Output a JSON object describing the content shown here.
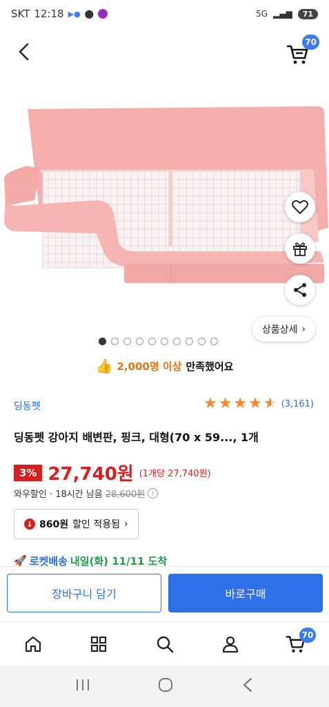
{
  "status_bar": {
    "carrier": "SKT",
    "time": "12:18",
    "network": "5G",
    "battery": "71"
  },
  "header": {
    "cart_count": "70"
  },
  "product_image": {
    "dot_count": 10,
    "active_index": 0,
    "detail_label": "상품상세",
    "colors": {
      "tray": "#f6b7b4",
      "tray_dark": "#e99f9a",
      "grid": "#f8f4f4"
    }
  },
  "satisfaction": {
    "highlight": "2,000명 이상",
    "suffix": "만족했어요"
  },
  "product": {
    "brand": "딩동펫",
    "rating": 4.5,
    "review_count": "(3,161)",
    "title": "딩동펫 강아지 배변판, 핑크, 대형(70 x 59..., 1개",
    "discount": "3%",
    "price": "27,740원",
    "unit_price": "(1개당 27,740원)",
    "wow_label": "와우할인 · 18시간 남음",
    "original_price": "28,600원",
    "coupon_amount": "860원",
    "coupon_label": "할인 적용됨",
    "delivery_rocket": "로켓배송",
    "delivery_date": "내일(화) 11/11 도착"
  },
  "actions": {
    "add_to_cart": "장바구니 담기",
    "buy_now": "바로구매"
  },
  "bottom_nav": {
    "cart_count": "70",
    "items": [
      "home-icon",
      "category-icon",
      "search-icon",
      "my-icon",
      "cart-icon"
    ]
  },
  "accent_colors": {
    "primary_blue": "#2f6fe8",
    "price_red": "#d32020",
    "star_orange": "#f5862a",
    "rocket_green": "#1c9e4a"
  }
}
